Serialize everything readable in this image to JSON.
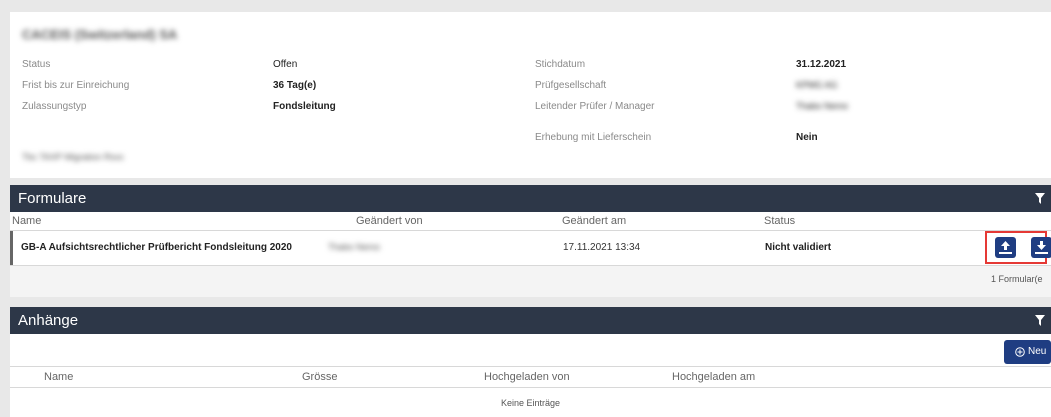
{
  "header": {
    "company": "CACEIS (Switzerland) SA",
    "status_label": "Status",
    "status_value": "Offen",
    "deadline_label": "Frist bis zur Einreichung",
    "deadline_value": "36 Tag(e)",
    "type_label": "Zulassungstyp",
    "type_value": "Fondsleitung",
    "date_label": "Stichdatum",
    "date_value": "31.12.2021",
    "audit_label": "Prüfgesellschaft",
    "audit_value": "KPMG AG",
    "manager_label": "Leitender Prüfer / Manager",
    "manager_value": "Thabo Nemo",
    "delivery_label": "Erhebung mit Lieferschein",
    "delivery_value": "Nein",
    "footer_note": "Tbc TAXP Migration Rsvc"
  },
  "forms": {
    "title": "Formulare",
    "columns": [
      "Name",
      "Geändert von",
      "Geändert am",
      "Status"
    ],
    "rows": [
      {
        "name": "GB-A Aufsichtsrechtlicher Prüfbericht Fondsleitung 2020",
        "changed_by": "Thabo Nemo",
        "changed_at": "17.11.2021 13:34",
        "status": "Nicht validiert"
      }
    ],
    "count": "1 Formular(e"
  },
  "attachments": {
    "title": "Anhänge",
    "new_button": "Neu",
    "columns": [
      "Name",
      "Grösse",
      "Hochgeladen von",
      "Hochgeladen am"
    ],
    "empty": "Keine Einträge"
  },
  "colors": {
    "header_bg": "#2d3748",
    "button_blue": "#1f3d82",
    "highlight_red": "#e53935"
  }
}
